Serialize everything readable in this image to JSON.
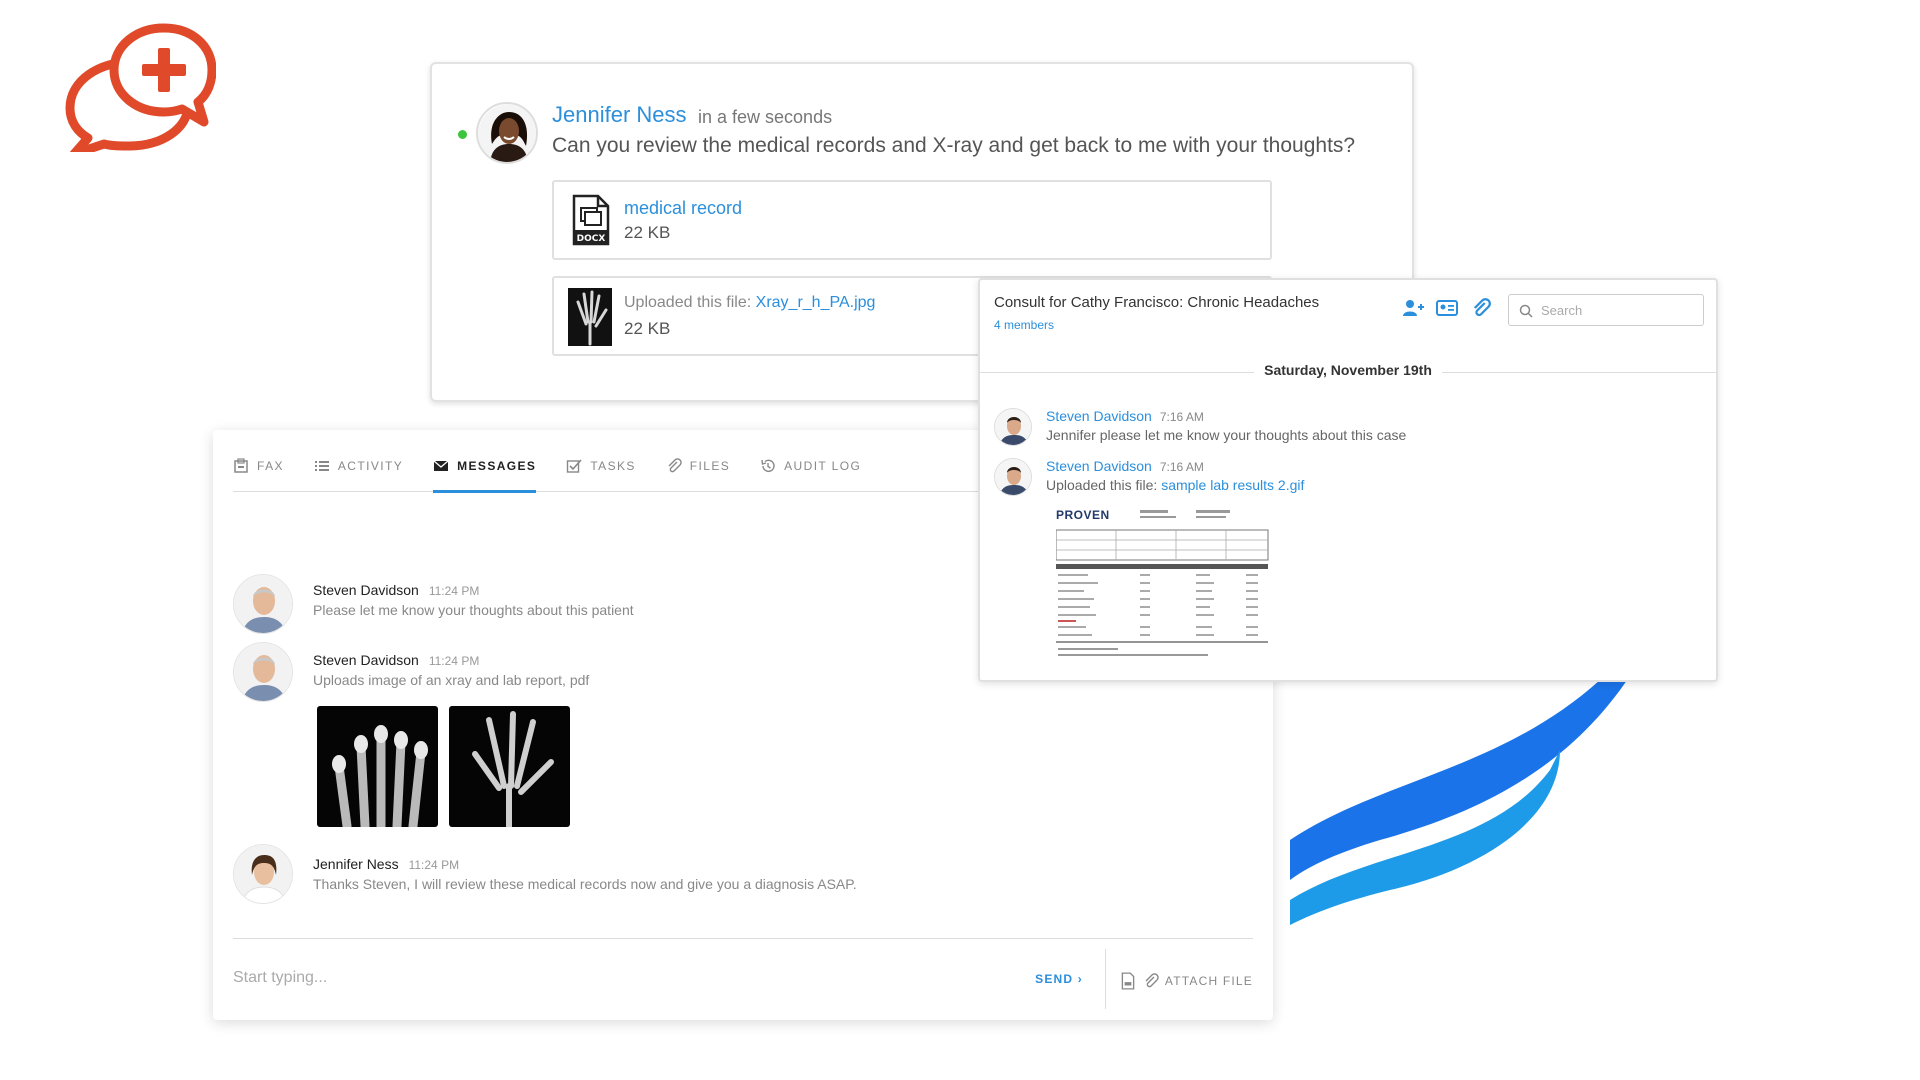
{
  "top_message": {
    "sender": "Jennifer Ness",
    "time": "in a few seconds",
    "text": "Can you review the medical records and X-ray and get back to me with your thoughts?",
    "attachments": [
      {
        "name": "medical record",
        "size": "22 KB",
        "type_label": "DOCX"
      },
      {
        "prefix": "Uploaded this file:",
        "name": "Xray_r_h_PA.jpg",
        "size": "22 KB"
      }
    ]
  },
  "tabs": [
    {
      "label": "FAX",
      "icon": "fax-icon"
    },
    {
      "label": "ACTIVITY",
      "icon": "list-icon"
    },
    {
      "label": "MESSAGES",
      "icon": "envelope-icon",
      "active": true
    },
    {
      "label": "TASKS",
      "icon": "checkbox-icon"
    },
    {
      "label": "FILES",
      "icon": "paperclip-icon"
    },
    {
      "label": "AUDIT LOG",
      "icon": "history-icon"
    }
  ],
  "messages": [
    {
      "sender": "Steven Davidson",
      "time": "11:24 PM",
      "text": "Please let me know your thoughts about this patient"
    },
    {
      "sender": "Steven Davidson",
      "time": "11:24 PM",
      "text": "Uploads image of an xray and lab report, pdf"
    },
    {
      "sender": "Jennifer Ness",
      "time": "11:24 PM",
      "text": "Thanks Steven, I will review these medical records now and give you a diagnosis ASAP."
    }
  ],
  "composer": {
    "placeholder": "Start typing...",
    "send_label": "SEND",
    "attach_label": "ATTACH FILE"
  },
  "consult": {
    "title": "Consult for Cathy Francisco: Chronic Headaches",
    "members": "4 members",
    "search_placeholder": "Search",
    "date": "Saturday, November 19th",
    "messages": [
      {
        "sender": "Steven Davidson",
        "time": "7:16 AM",
        "text": "Jennifer please let me know your thoughts about this case"
      },
      {
        "sender": "Steven Davidson",
        "time": "7:16 AM",
        "prefix": "Uploaded this file:",
        "file": "sample lab results 2.gif"
      }
    ],
    "lab_brand": "PROVEN"
  },
  "colors": {
    "accent": "#2b8fdc",
    "logo": "#e04a2a",
    "swoosh_dark": "#1a73e8",
    "swoosh_light": "#1e9be8",
    "online": "#3cc43c"
  }
}
